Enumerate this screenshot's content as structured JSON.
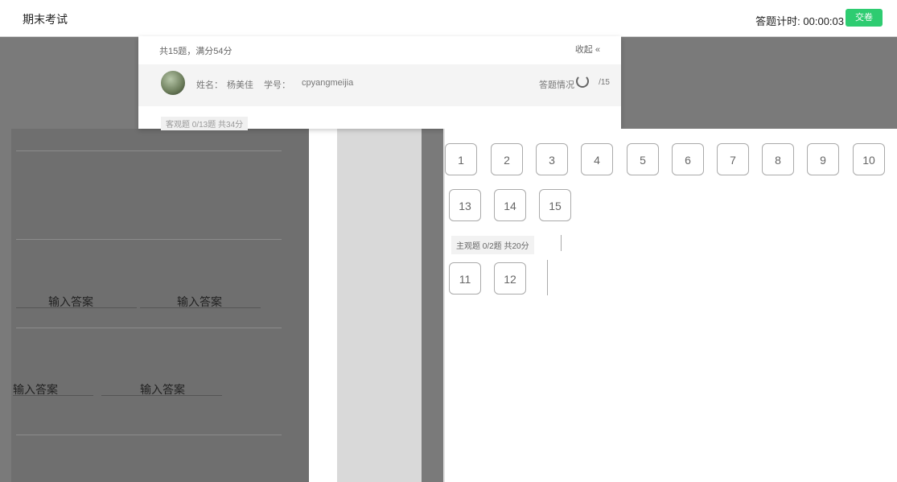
{
  "header": {
    "title": "期末考试",
    "timer_label": "答题计时:",
    "timer_value": "00:00:03",
    "submit_label": "交卷"
  },
  "popup": {
    "summary": "共15题，满分54分",
    "collapse_label": "收起 «",
    "user": {
      "name_label": "姓名：",
      "name": "杨美佳",
      "id_label": "学号：",
      "id": "cpyangmeijia"
    },
    "answer_status_label": "答题情况",
    "answer_status_count": "/15",
    "objective_section": "客观题 0/13题 共34分"
  },
  "left_panel": {
    "answer_inputs": [
      "输入答案",
      "输入答案",
      "输入答案",
      "输入答案"
    ]
  },
  "question_panel": {
    "objective_numbers": [
      "1",
      "2",
      "3",
      "4",
      "5",
      "6",
      "7",
      "8",
      "9",
      "10",
      "13",
      "14",
      "15"
    ],
    "subjective_section": "主观题 0/2题 共20分",
    "subjective_numbers": [
      "11",
      "12"
    ]
  },
  "colors": {
    "accent_green": "#2ecc71",
    "dark_bg": "#7a7a7a"
  }
}
